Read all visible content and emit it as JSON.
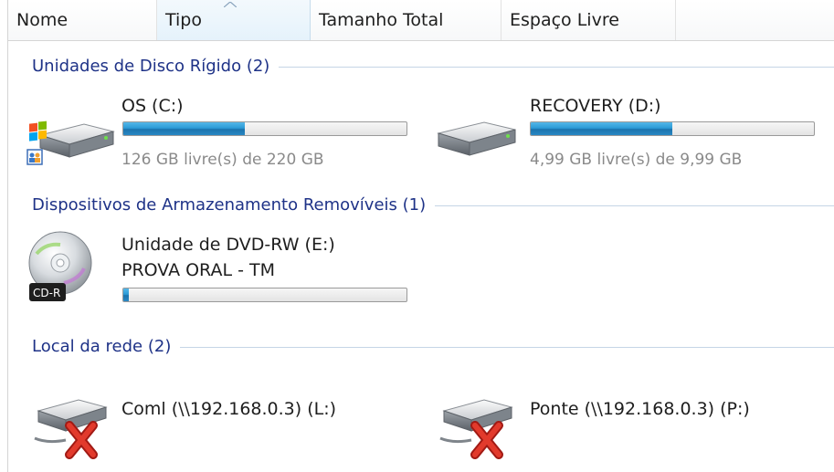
{
  "columns": [
    {
      "label": "Nome"
    },
    {
      "label": "Tipo"
    },
    {
      "label": "Tamanho Total"
    },
    {
      "label": "Espaço Livre"
    }
  ],
  "groups": {
    "hard_disks": {
      "label": "Unidades de Disco Rígido (2)",
      "items": [
        {
          "name": "OS (C:)",
          "space": "126 GB livre(s) de 220 GB",
          "used_fraction": 0.43,
          "icon": "system-drive-icon"
        },
        {
          "name": "RECOVERY (D:)",
          "space": "4,99 GB livre(s) de 9,99 GB",
          "used_fraction": 0.5,
          "icon": "hard-drive-icon"
        }
      ]
    },
    "removable": {
      "label": "Dispositivos de Armazenamento Removíveis (1)",
      "items": [
        {
          "name": "Unidade de DVD-RW (E:)",
          "volume": "PROVA ORAL - TM",
          "used_fraction": 0.02,
          "icon": "cd-r-disc-icon",
          "badge": "CD-R"
        }
      ]
    },
    "network": {
      "label": "Local da rede (2)",
      "items": [
        {
          "name": "Coml (\\\\192.168.0.3) (L:)",
          "icon": "disconnected-network-drive-icon"
        },
        {
          "name": "Ponte (\\\\192.168.0.3) (P:)",
          "icon": "disconnected-network-drive-icon"
        }
      ]
    }
  },
  "colors": {
    "group_label": "#1e3287",
    "progress_fill": "#2c9bd6",
    "disconnected_x": "#d8281e"
  }
}
